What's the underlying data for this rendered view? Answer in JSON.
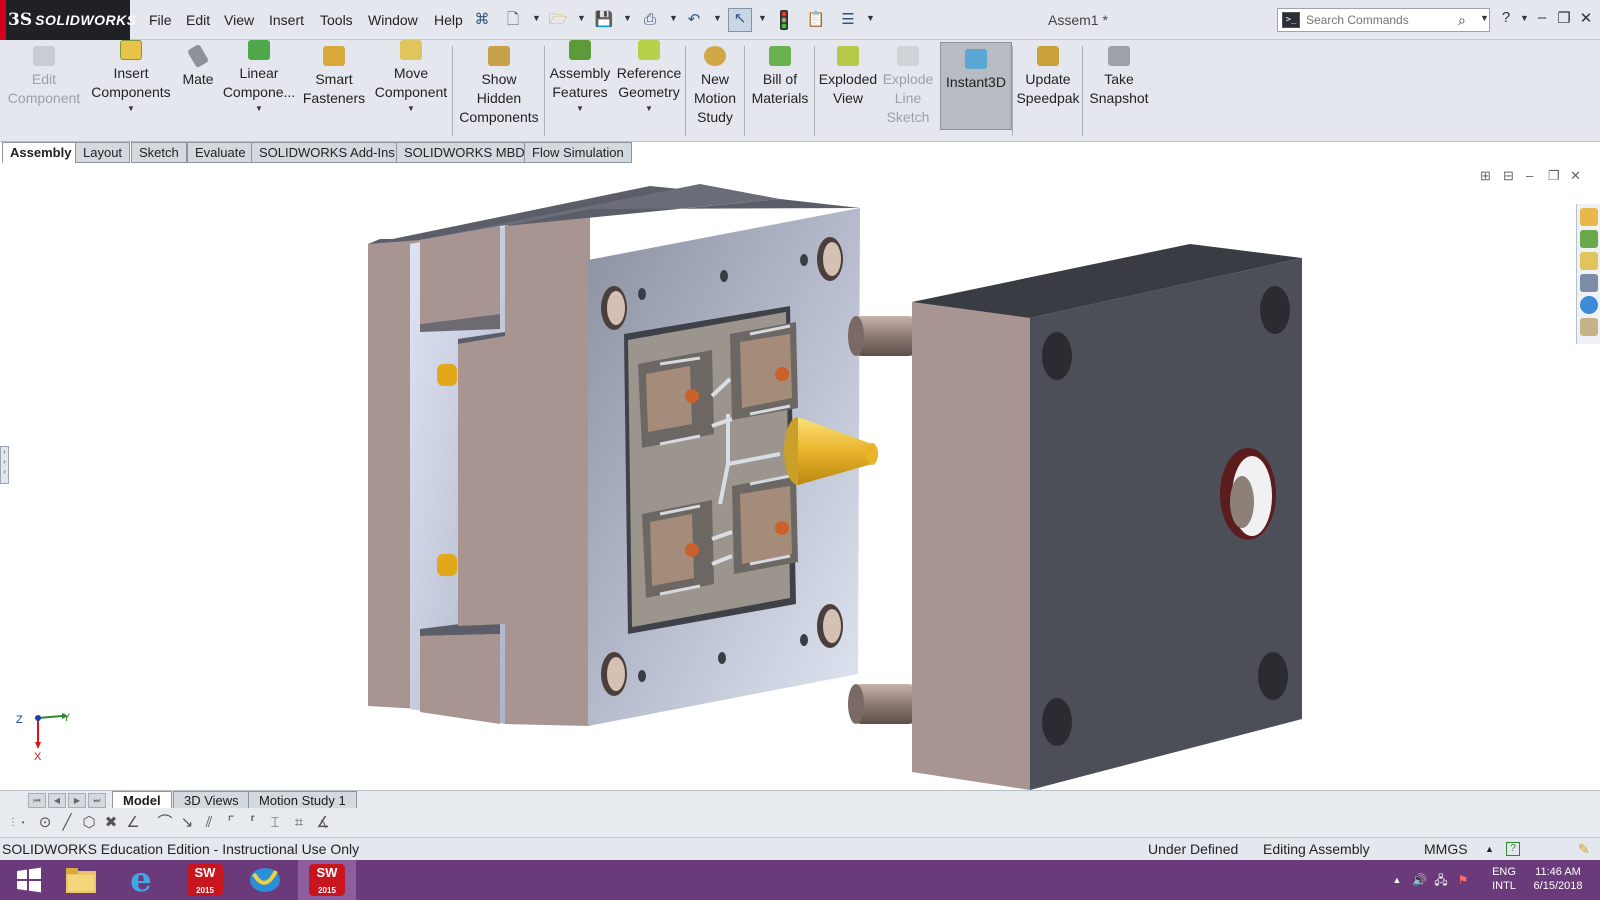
{
  "app": {
    "brand": "SOLIDWORKS",
    "brand_prefix": "3S",
    "document_title": "Assem1 *"
  },
  "menu": [
    "File",
    "Edit",
    "View",
    "Insert",
    "Tools",
    "Window",
    "Help"
  ],
  "search": {
    "placeholder": "Search Commands"
  },
  "ribbon": {
    "commands": [
      {
        "label": "Edit\nComponent",
        "icon": "edit-component-icon",
        "disabled": true
      },
      {
        "label": "Insert\nComponents",
        "icon": "insert-components-icon",
        "dropdown": true
      },
      {
        "label": "Mate",
        "icon": "mate-icon"
      },
      {
        "label": "Linear\nCompone...",
        "icon": "linear-pattern-icon",
        "dropdown": true
      },
      {
        "label": "Smart\nFasteners",
        "icon": "smart-fasteners-icon"
      },
      {
        "label": "Move\nComponent",
        "icon": "move-component-icon",
        "dropdown": true
      },
      {
        "label": "Show\nHidden\nComponents",
        "icon": "show-hidden-icon"
      },
      {
        "label": "Assembly\nFeatures",
        "icon": "assembly-features-icon",
        "dropdown": true
      },
      {
        "label": "Reference\nGeometry",
        "icon": "reference-geometry-icon",
        "dropdown": true
      },
      {
        "label": "New\nMotion\nStudy",
        "icon": "motion-study-icon"
      },
      {
        "label": "Bill of\nMaterials",
        "icon": "bill-of-materials-icon"
      },
      {
        "label": "Exploded\nView",
        "icon": "exploded-view-icon"
      },
      {
        "label": "Explode\nLine\nSketch",
        "icon": "explode-line-icon",
        "disabled": true
      },
      {
        "label": "Instant3D",
        "icon": "instant3d-icon",
        "active": true
      },
      {
        "label": "Update\nSpeedpak",
        "icon": "speedpak-icon"
      },
      {
        "label": "Take\nSnapshot",
        "icon": "snapshot-icon"
      }
    ]
  },
  "tabs": [
    "Assembly",
    "Layout",
    "Sketch",
    "Evaluate",
    "SOLIDWORKS Add-Ins",
    "SOLIDWORKS MBD",
    "Flow Simulation"
  ],
  "active_tab": "Assembly",
  "triad": {
    "z": "Z",
    "y": "Y",
    "x": "X"
  },
  "bottom_tabs": [
    "Model",
    "3D Views",
    "Motion Study 1"
  ],
  "active_bottom_tab": "Model",
  "status": {
    "edition": "SOLIDWORKS Education Edition - Instructional Use Only",
    "definition": "Under Defined",
    "mode": "Editing Assembly",
    "units": "MMGS"
  },
  "taskbar": {
    "lang_top": "ENG",
    "lang_bottom": "INTL",
    "time": "11:46 AM",
    "date": "6/15/2018",
    "apps": [
      {
        "name": "start-button"
      },
      {
        "name": "file-explorer"
      },
      {
        "name": "internet-explorer"
      },
      {
        "name": "solidworks-2015",
        "badge": "2015"
      },
      {
        "name": "app-launcher"
      },
      {
        "name": "solidworks-2015-active",
        "badge": "2015"
      }
    ]
  },
  "colors": {
    "taskbar": "#6b3a7b",
    "mold_plate_face": "#9aa0ad",
    "mold_plate_side": "#a89490",
    "cavity_plate": "#4c4f58",
    "sprue": "#f2c230"
  }
}
